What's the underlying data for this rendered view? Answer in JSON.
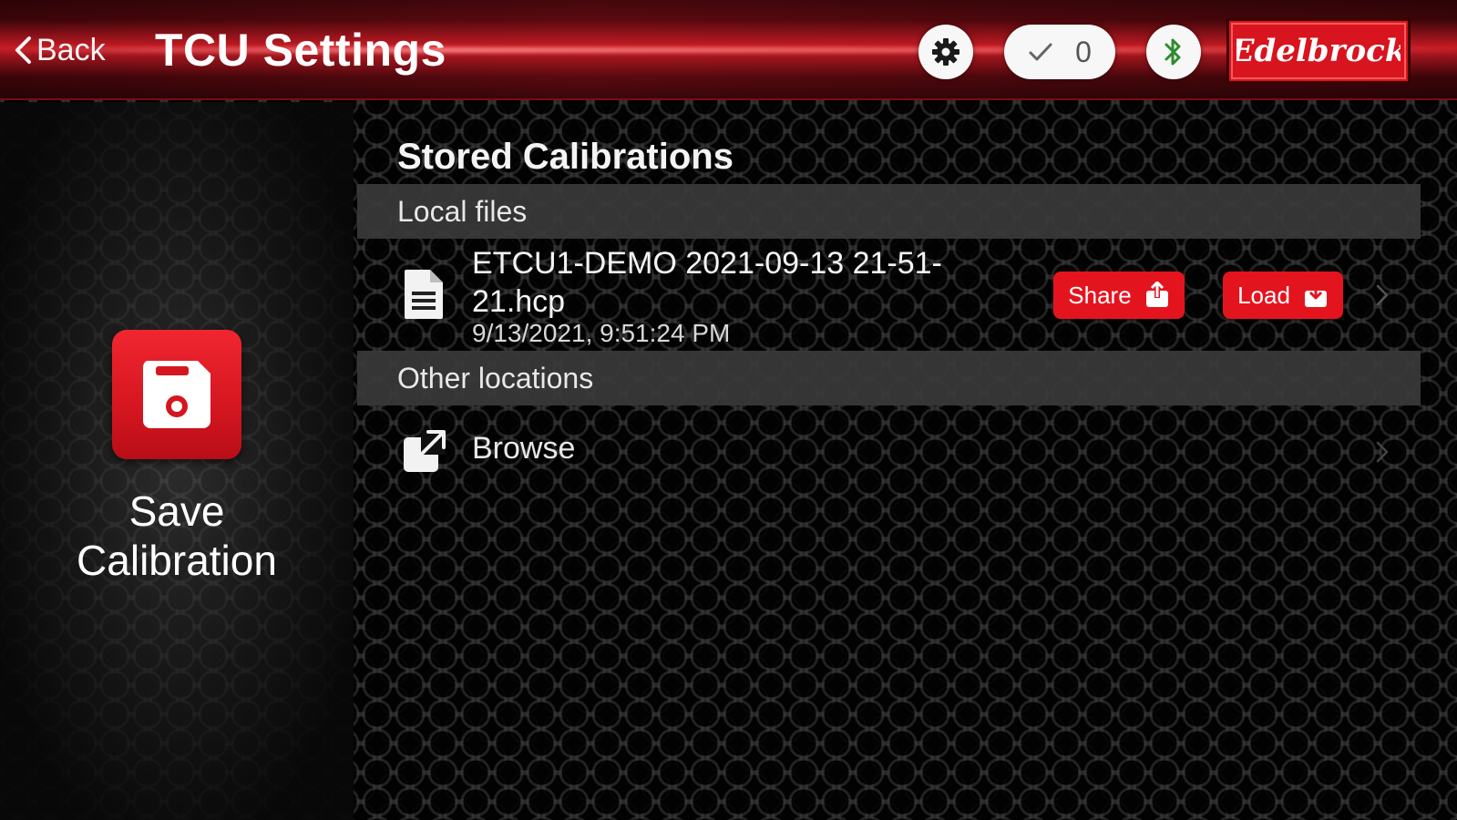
{
  "header": {
    "back_label": "Back",
    "title": "TCU Settings",
    "status_count": "0",
    "brand": "Edelbrock"
  },
  "colors": {
    "accent": "#e4141f",
    "header_red": "#d8141f",
    "panel_gray": "#3a3a3a"
  },
  "icons": {
    "back": "chevron-left-icon",
    "settings": "gear-icon",
    "status": "check-icon",
    "bluetooth": "bluetooth-icon",
    "save": "floppy-disk-icon",
    "file": "document-icon",
    "share": "share-icon",
    "load": "download-icon",
    "browse": "external-link-icon",
    "row_chevron": "chevron-right-icon"
  },
  "left_panel": {
    "save_label": "Save Calibration"
  },
  "main": {
    "section_title": "Stored Calibrations",
    "local_header": "Local files",
    "files": [
      {
        "name": "ETCU1-DEMO 2021-09-13 21-51-21.hcp",
        "date": "9/13/2021, 9:51:24 PM",
        "share_label": "Share",
        "load_label": "Load"
      }
    ],
    "other_header": "Other locations",
    "browse_label": "Browse"
  }
}
